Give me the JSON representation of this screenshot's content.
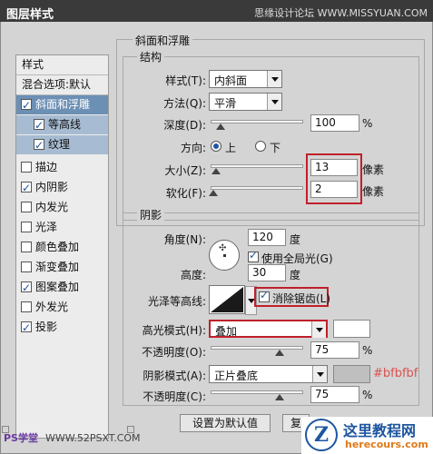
{
  "window": {
    "title": "图层样式",
    "watermark": "思缘设计论坛 WWW.MISSYUAN.COM"
  },
  "sidebar": {
    "header": "样式",
    "blend": "混合选项:默认",
    "items": [
      {
        "label": "斜面和浮雕",
        "checked": true
      },
      {
        "label": "等高线",
        "checked": true
      },
      {
        "label": "纹理",
        "checked": true
      },
      {
        "label": "描边",
        "checked": false
      },
      {
        "label": "内阴影",
        "checked": true
      },
      {
        "label": "内发光",
        "checked": false
      },
      {
        "label": "光泽",
        "checked": false
      },
      {
        "label": "颜色叠加",
        "checked": false
      },
      {
        "label": "渐变叠加",
        "checked": false
      },
      {
        "label": "图案叠加",
        "checked": true
      },
      {
        "label": "外发光",
        "checked": false
      },
      {
        "label": "投影",
        "checked": true
      }
    ]
  },
  "bevel": {
    "section_title": "斜面和浮雕",
    "structure_title": "结构",
    "style_label": "样式(T):",
    "style_value": "内斜面",
    "technique_label": "方法(Q):",
    "technique_value": "平滑",
    "depth_label": "深度(D):",
    "depth_value": "100",
    "depth_unit": "%",
    "depth_fraction": 0.1,
    "direction_label": "方向:",
    "direction_up": "上",
    "direction_down": "下",
    "size_label": "大小(Z):",
    "size_value": "13",
    "size_unit": "像素",
    "size_fraction": 0.05,
    "soften_label": "软化(F):",
    "soften_value": "2",
    "soften_unit": "像素",
    "soften_fraction": 0.02
  },
  "shading": {
    "section_title": "阴影",
    "angle_label": "角度(N):",
    "angle_value": "120",
    "angle_unit": "度",
    "global_light_label": "使用全局光(G)",
    "altitude_label": "高度:",
    "altitude_value": "30",
    "altitude_unit": "度",
    "gloss_label": "光泽等高线:",
    "antialias_label": "消除锯齿(L)",
    "highlight_mode_label": "高光模式(H):",
    "highlight_mode_value": "叠加",
    "highlight_color": "#ffffff",
    "highlight_opacity_label": "不透明度(O):",
    "highlight_opacity_value": "75",
    "highlight_opacity_unit": "%",
    "highlight_opacity_fraction": 0.75,
    "shadow_mode_label": "阴影模式(A):",
    "shadow_mode_value": "正片叠底",
    "shadow_color": "#bfbfbf",
    "shadow_color_note": "#bfbfbf",
    "shadow_opacity_label": "不透明度(C):",
    "shadow_opacity_value": "75",
    "shadow_opacity_unit": "%",
    "shadow_opacity_fraction": 0.75
  },
  "buttons": {
    "make_default": "设置为默认值",
    "reset": "复"
  },
  "site": {
    "name": "PS学堂",
    "url": "WWW.52PSXT.COM",
    "logo_name": "这里教程网",
    "logo_url": "herecours.com",
    "logo_mark": "Z"
  }
}
